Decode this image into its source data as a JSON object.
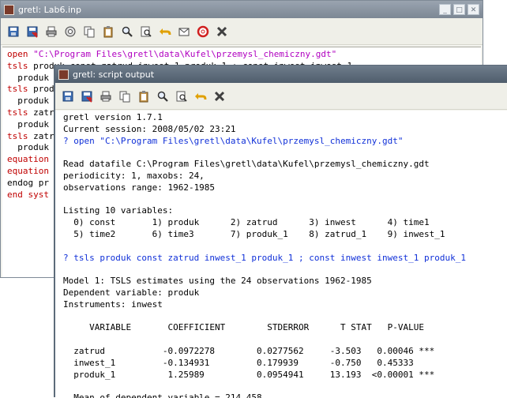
{
  "editor": {
    "title": "gretl: Lab6.inp",
    "controls": [
      "_",
      "□",
      "✕"
    ],
    "toolbar": [
      "save-icon",
      "save-as-icon",
      "print-icon",
      "run-icon",
      "copy-icon",
      "paste-icon",
      "find-icon",
      "replace-icon",
      "undo-icon",
      "mail-icon",
      "help-icon",
      "close-icon"
    ],
    "script_lines": [
      [
        {
          "t": "open ",
          "c": "red"
        },
        {
          "t": "\"C:\\Program Files\\gretl\\data\\Kufel\\przemysl_chemiczny.gdt\"",
          "c": "magenta"
        }
      ],
      [
        {
          "t": "tsls ",
          "c": "red"
        },
        {
          "t": "produk const zatrud inwest_1 produk_1 ; const inwest inwest_1",
          "c": ""
        }
      ],
      [
        {
          "t": "  produk",
          "c": ""
        }
      ],
      [
        {
          "t": "tsls ",
          "c": "red"
        },
        {
          "t": "produk",
          "c": ""
        }
      ],
      [
        {
          "t": "  produk",
          "c": ""
        }
      ],
      [
        {
          "t": "tsls ",
          "c": "red"
        },
        {
          "t": "zatrud",
          "c": ""
        }
      ],
      [
        {
          "t": "  produk",
          "c": ""
        }
      ],
      [
        {
          "t": "tsls ",
          "c": "red"
        },
        {
          "t": "zatrud",
          "c": ""
        }
      ],
      [
        {
          "t": "  produk",
          "c": ""
        }
      ],
      [
        {
          "t": "equation",
          "c": "red"
        }
      ],
      [
        {
          "t": "equation",
          "c": "red"
        }
      ],
      [
        {
          "t": "endog pr",
          "c": ""
        }
      ],
      [
        {
          "t": "end syst",
          "c": "red"
        }
      ]
    ]
  },
  "output": {
    "title": "gretl: script output",
    "toolbar": [
      "save-icon",
      "save-as-icon",
      "print-icon",
      "copy-icon",
      "paste-icon",
      "find-icon",
      "replace-icon",
      "undo-icon",
      "close-icon"
    ],
    "lines": [
      {
        "t": "gretl version 1.7.1",
        "c": ""
      },
      {
        "t": "Current session: 2008/05/02 23:21",
        "c": ""
      },
      {
        "t": "? open \"C:\\Program Files\\gretl\\data\\Kufel\\przemysl_chemiczny.gdt\"",
        "c": "blue"
      },
      {
        "t": "",
        "c": ""
      },
      {
        "t": "Read datafile C:\\Program Files\\gretl\\data\\Kufel\\przemysl_chemiczny.gdt",
        "c": ""
      },
      {
        "t": "periodicity: 1, maxobs: 24,",
        "c": ""
      },
      {
        "t": "observations range: 1962-1985",
        "c": ""
      },
      {
        "t": "",
        "c": ""
      },
      {
        "t": "Listing 10 variables:",
        "c": ""
      },
      {
        "t": "  0) const       1) produk      2) zatrud      3) inwest      4) time1",
        "c": ""
      },
      {
        "t": "  5) time2       6) time3       7) produk_1    8) zatrud_1    9) inwest_1",
        "c": ""
      },
      {
        "t": "",
        "c": ""
      },
      {
        "t": "? tsls produk const zatrud inwest_1 produk_1 ; const inwest inwest_1 produk_1",
        "c": "blue"
      },
      {
        "t": "",
        "c": ""
      },
      {
        "t": "Model 1: TSLS estimates using the 24 observations 1962-1985",
        "c": ""
      },
      {
        "t": "Dependent variable: produk",
        "c": ""
      },
      {
        "t": "Instruments: inwest",
        "c": ""
      },
      {
        "t": "",
        "c": ""
      },
      {
        "t": "     VARIABLE       COEFFICIENT        STDERROR      T STAT   P-VALUE",
        "c": ""
      },
      {
        "t": "",
        "c": ""
      },
      {
        "t": "  zatrud           -0.0972278        0.0277562     -3.503   0.00046 ***",
        "c": ""
      },
      {
        "t": "  inwest_1         -0.134931         0.179939      -0.750   0.45333",
        "c": ""
      },
      {
        "t": "  produk_1          1.25989          0.0954941     13.193  <0.00001 ***",
        "c": ""
      },
      {
        "t": "",
        "c": ""
      },
      {
        "t": "  Mean of dependent variable = 214.458",
        "c": ""
      }
    ]
  }
}
